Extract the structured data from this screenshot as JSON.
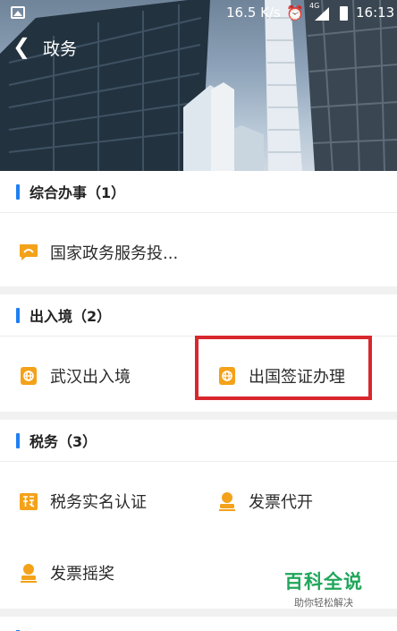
{
  "status_bar": {
    "network_speed": "16.5 K/s",
    "network_type": "4G",
    "time": "16:13"
  },
  "nav": {
    "back_icon": "chevron-left-icon",
    "title": "政务"
  },
  "sections": [
    {
      "header": "综合办事（1）",
      "items": [
        {
          "label": "国家政务服务投...",
          "icon": "chat-bubble-icon"
        }
      ]
    },
    {
      "header": "出入境（2）",
      "items": [
        {
          "label": "武汉出入境",
          "icon": "passport-globe-icon"
        },
        {
          "label": "出国签证办理",
          "icon": "passport-globe-icon"
        }
      ]
    },
    {
      "header": "税务（3）",
      "items": [
        {
          "label": "税务实名认证",
          "icon": "tax-seal-icon"
        },
        {
          "label": "发票代开",
          "icon": "user-stamp-icon"
        },
        {
          "label": "发票摇奖",
          "icon": "user-stamp-icon"
        }
      ]
    }
  ],
  "watermark": {
    "brand": "百科全说",
    "tagline": "助你轻松解决"
  },
  "colors": {
    "accent_bar": "#1f7ff2",
    "icon_orange": "#f3a21a",
    "highlight_red": "#d9272e",
    "watermark_green": "#20a65a"
  }
}
